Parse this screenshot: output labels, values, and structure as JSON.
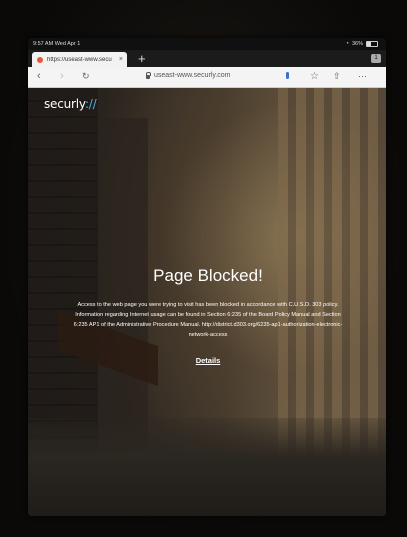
{
  "status_bar": {
    "time": "9:57 AM   Wed Apr 1",
    "battery": "36%"
  },
  "browser": {
    "tab": {
      "title": "https://useast-www.secu",
      "close_icon": "×"
    },
    "new_tab_icon": "+",
    "tab_count": "1",
    "address": "useast-www.securly.com",
    "icons": {
      "back": "back-chevron-icon",
      "forward": "forward-chevron-icon",
      "reload": "reload-icon",
      "lock": "lock-icon",
      "mic": "microphone-icon",
      "bookmark": "star-icon",
      "share": "share-icon",
      "more": "ellipsis-icon"
    }
  },
  "page": {
    "logo_main": "securly",
    "logo_accent": "://",
    "title": "Page Blocked!",
    "message": "Access to the web page you were trying to visit has been blocked in accordance with C.U.S.D. 303 policy. Information regarding Internet usage can be found in Section 6:235 of the Board Policy Manual and Section 6:235 AP1 of the Administrative Procedure Manual. http://district.d303.org/6235-ap1-authorization-electronic-network-access",
    "details_link": "Details"
  },
  "colors": {
    "logo_accent": "#4fb3e8",
    "mic": "#3b6fd8",
    "favicon": "#e8593a"
  }
}
